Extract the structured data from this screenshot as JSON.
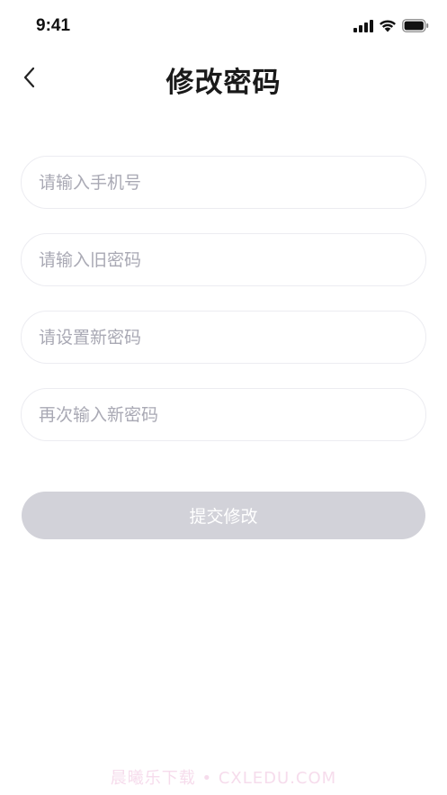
{
  "status_bar": {
    "time": "9:41",
    "icons": [
      "cellular-signal-icon",
      "wifi-icon",
      "battery-icon"
    ]
  },
  "nav": {
    "title": "修改密码",
    "back_icon": "chevron-left-icon"
  },
  "form": {
    "phone_placeholder": "请输入手机号",
    "old_password_placeholder": "请输入旧密码",
    "new_password_placeholder": "请设置新密码",
    "confirm_password_placeholder": "再次输入新密码",
    "submit_label": "提交修改"
  },
  "watermark": "晨曦乐下载 • CXLEDU.COM",
  "colors": {
    "background": "#ffffff",
    "field_border": "#ececf1",
    "placeholder": "#a9a9b4",
    "submit_disabled": "#d2d2d9",
    "title": "#1a1a1a"
  }
}
